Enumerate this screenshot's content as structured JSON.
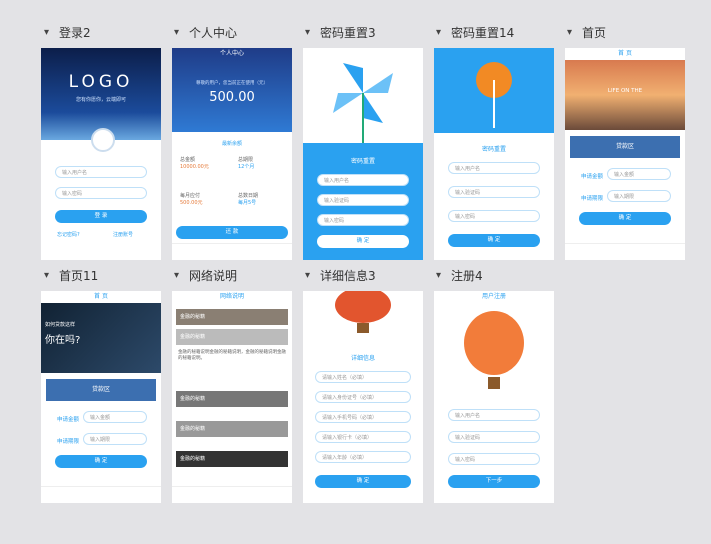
{
  "screens": [
    {
      "title": "登录2"
    },
    {
      "title": "个人中心"
    },
    {
      "title": "密码重置3"
    },
    {
      "title": "密码重置14"
    },
    {
      "title": "首页"
    },
    {
      "title": "首页11"
    },
    {
      "title": "网络说明"
    },
    {
      "title": "详细信息3"
    },
    {
      "title": "注册4"
    }
  ],
  "login": {
    "logo": "LOGO",
    "slogan": "您有你愿你，云端即可",
    "user_ph": "输入用户名",
    "pwd_ph": "输入密码",
    "login_btn": "登 录",
    "forgot": "忘记密码?",
    "register": "注册账号"
  },
  "personal": {
    "title": "个人中心",
    "balance_label": "最新余额",
    "balance": "500.00",
    "greeting": "尊敬的用户，您当前正在使用（元）",
    "items": [
      {
        "name": "总金额",
        "val": "10000.00元"
      },
      {
        "name": "总期限",
        "val": "12个月"
      },
      {
        "name": "每月应付",
        "val": "500.00元"
      },
      {
        "name": "总数日期",
        "val": "每月5号"
      }
    ],
    "more": "查看更多",
    "btn": "还 款"
  },
  "reset3": {
    "section": "密码重置",
    "phone_ph": "输入用户名",
    "code_ph": "输入验证码",
    "code_btn": "获取验证码",
    "new_ph": "输入密码",
    "btn": "确 定"
  },
  "reset14": {
    "section": "密码重置",
    "phone_ph": "输入用户名",
    "code_ph": "输入验证码",
    "code_btn": "获取验证码",
    "new_ph": "输入密码",
    "btn": "确 定"
  },
  "home": {
    "title": "首 页",
    "hero": "LIFE ON THE",
    "banner": "贷款区",
    "field1_label": "申请金额",
    "field1_ph": "输入金额",
    "field2_label": "申请期限",
    "field2_ph": "输入期限",
    "btn": "确 定"
  },
  "home11": {
    "title": "首 页",
    "hero_line1": "如何贷款这样",
    "hero_line2": "你在吗?",
    "banner": "贷款区",
    "field1_label": "申请金额",
    "field1_ph": "输入金额",
    "field2_label": "申请期限",
    "field2_ph": "输入期限",
    "btn": "确 定"
  },
  "network": {
    "title": "网络说明",
    "items": [
      "金融的秘籍",
      "金融的秘籍",
      "金融的秘籍",
      "金融的秘籍",
      "金融的秘籍"
    ],
    "para": "金融的秘籍说明金融的秘籍说明，金融的秘籍说明金融的秘籍说明。"
  },
  "detail": {
    "section": "详细信息",
    "fields": [
      "请输入姓名（必填）",
      "请输入身份证号（必填）",
      "请输入手机号码（必填）",
      "请输入银行卡（必填）",
      "请输入年龄（必填）"
    ],
    "btn": "确 定"
  },
  "register": {
    "title": "用户注册",
    "phone_ph": "输入用户名",
    "code_ph": "输入验证码",
    "code_btn": "获取验证码",
    "pwd_ph": "输入密码",
    "btn": "下一步"
  }
}
